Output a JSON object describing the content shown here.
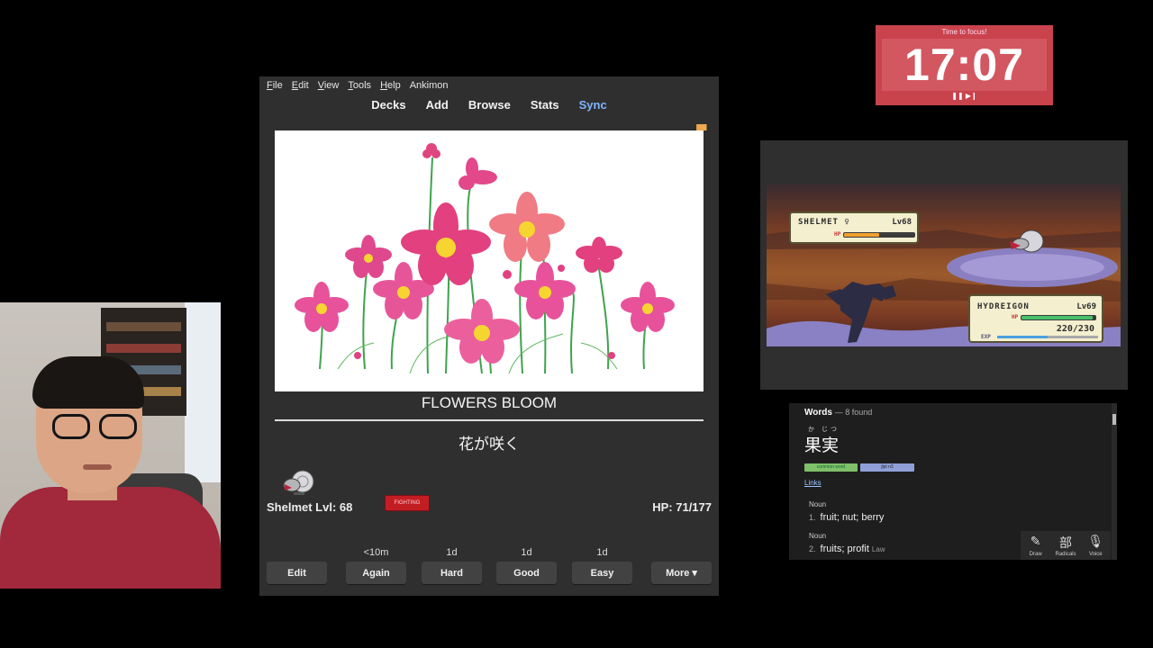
{
  "anki": {
    "menu": [
      "File",
      "Edit",
      "View",
      "Tools",
      "Help",
      "Ankimon"
    ],
    "toolbar": {
      "decks": "Decks",
      "add": "Add",
      "browse": "Browse",
      "stats": "Stats",
      "sync": "Sync"
    },
    "card": {
      "front": "FLOWERS BLOOM",
      "back": "花が咲く"
    },
    "pokemon": {
      "name_level": "Shelmet Lvl: 68",
      "type": "FIGHTING",
      "hp": "HP: 71/177"
    },
    "answers": {
      "edit": "Edit",
      "again": {
        "label": "Again",
        "interval": "<10m"
      },
      "hard": {
        "label": "Hard",
        "interval": "1d"
      },
      "good": {
        "label": "Good",
        "interval": "1d"
      },
      "easy": {
        "label": "Easy",
        "interval": "1d"
      },
      "more": "More ▾"
    }
  },
  "timer": {
    "caption": "Time to focus!",
    "time": "17:07",
    "controls": "❚❚ ▶❙"
  },
  "game": {
    "enemy": {
      "name": "SHELMET ♀",
      "level": "Lv68",
      "hp_label": "HP",
      "hp_fraction": 0.5
    },
    "player": {
      "name": "HYDREIGON",
      "level": "Lv69",
      "hp_label": "HP",
      "hp": "220/230",
      "exp_label": "EXP",
      "hp_fraction": 0.96
    }
  },
  "dict": {
    "header_title": "Words",
    "header_count": "— 8 found",
    "furigana": "か じつ",
    "headword": "果実",
    "tags": [
      "common word",
      "jlpt n3"
    ],
    "links": "Links",
    "pos1": "Noun",
    "sense1_num": "1.",
    "sense1": "fruit; nut; berry",
    "pos2": "Noun",
    "sense2_num": "2.",
    "sense2": "fruits; profit",
    "sense2_misc": "Law",
    "tools": [
      {
        "icon": "✎",
        "label": "Draw"
      },
      {
        "icon": "部",
        "label": "Radicals"
      },
      {
        "icon": "🎙",
        "label": "Voice"
      }
    ]
  },
  "colors": {
    "timer_bg": "#c9434d",
    "badge_red": "#c31d24",
    "sync_blue": "#7fb5ff",
    "tag_green": "#7fc06a",
    "tag_blue": "#8fa0d8"
  }
}
